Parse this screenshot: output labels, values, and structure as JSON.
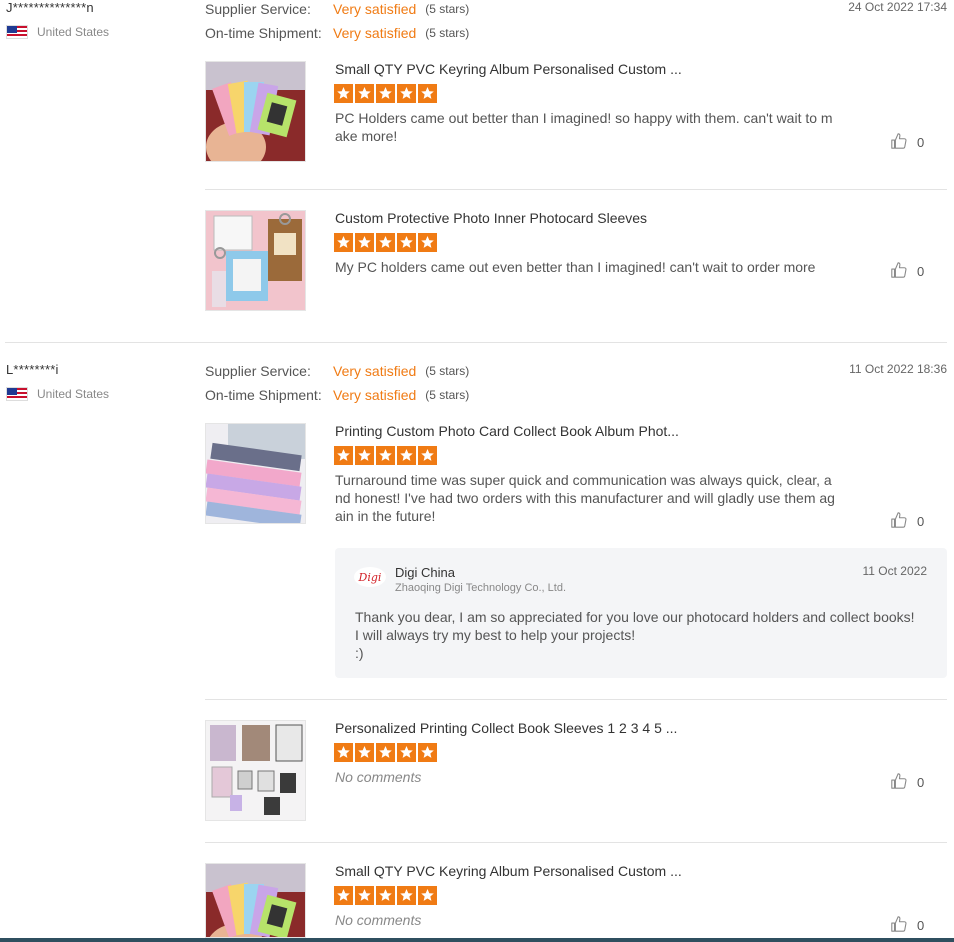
{
  "colors": {
    "accent": "#f07b14",
    "divider": "#e3e3e3",
    "reply_bg": "#f4f5f7"
  },
  "reviews": [
    {
      "user": "J**************n",
      "country": "United States",
      "date": "24 Oct 2022 17:34",
      "supplier_service": {
        "label": "Supplier Service:",
        "value": "Very satisfied",
        "stars": "(5 stars)"
      },
      "shipment": {
        "label": "On-time Shipment:",
        "value": "Very satisfied",
        "stars": "(5 stars)"
      },
      "products": [
        {
          "title": "Small QTY PVC Keyring Album Personalised Custom ...",
          "rating": 5,
          "comment": "PC Holders came out better than I imagined! so happy with them. can't wait to make more!",
          "likes": "0",
          "image": "keyring-album-photo"
        },
        {
          "title": "Custom Protective Photo Inner Photocard Sleeves",
          "rating": 5,
          "comment": "My PC holders came out even better than I imagined! can't wait to order more",
          "likes": "0",
          "image": "photocard-sleeves-photo"
        }
      ]
    },
    {
      "user": "L********i",
      "country": "United States",
      "date": "11 Oct 2022 18:36",
      "supplier_service": {
        "label": "Supplier Service:",
        "value": "Very satisfied",
        "stars": "(5 stars)"
      },
      "shipment": {
        "label": "On-time Shipment:",
        "value": "Very satisfied",
        "stars": "(5 stars)"
      },
      "products": [
        {
          "title": "Printing Custom Photo Card Collect Book Album Phot...",
          "rating": 5,
          "comment": "Turnaround time was super quick and communication was always quick, clear, and honest! I've had two orders with this manufacturer and will gladly use them again in the future!",
          "likes": "0",
          "image": "collect-book-album-photo",
          "reply": {
            "logo_text": "Digi",
            "name": "Digi China",
            "company": "Zhaoqing Digi Technology Co., Ltd.",
            "date": "11 Oct 2022",
            "text": "Thank you dear, I am so appreciated for you love our photocard holders and collect books!\nI will always try my best to help your projects!\n:)"
          }
        },
        {
          "title": "Personalized Printing Collect Book Sleeves 1 2 3 4 5 ...",
          "rating": 5,
          "comment": "No comments",
          "likes": "0",
          "image": "collect-book-sleeves-photo"
        },
        {
          "title": "Small QTY PVC Keyring Album Personalised Custom ...",
          "rating": 5,
          "comment": "No comments",
          "likes": "0",
          "image": "keyring-album-photo"
        }
      ]
    }
  ]
}
